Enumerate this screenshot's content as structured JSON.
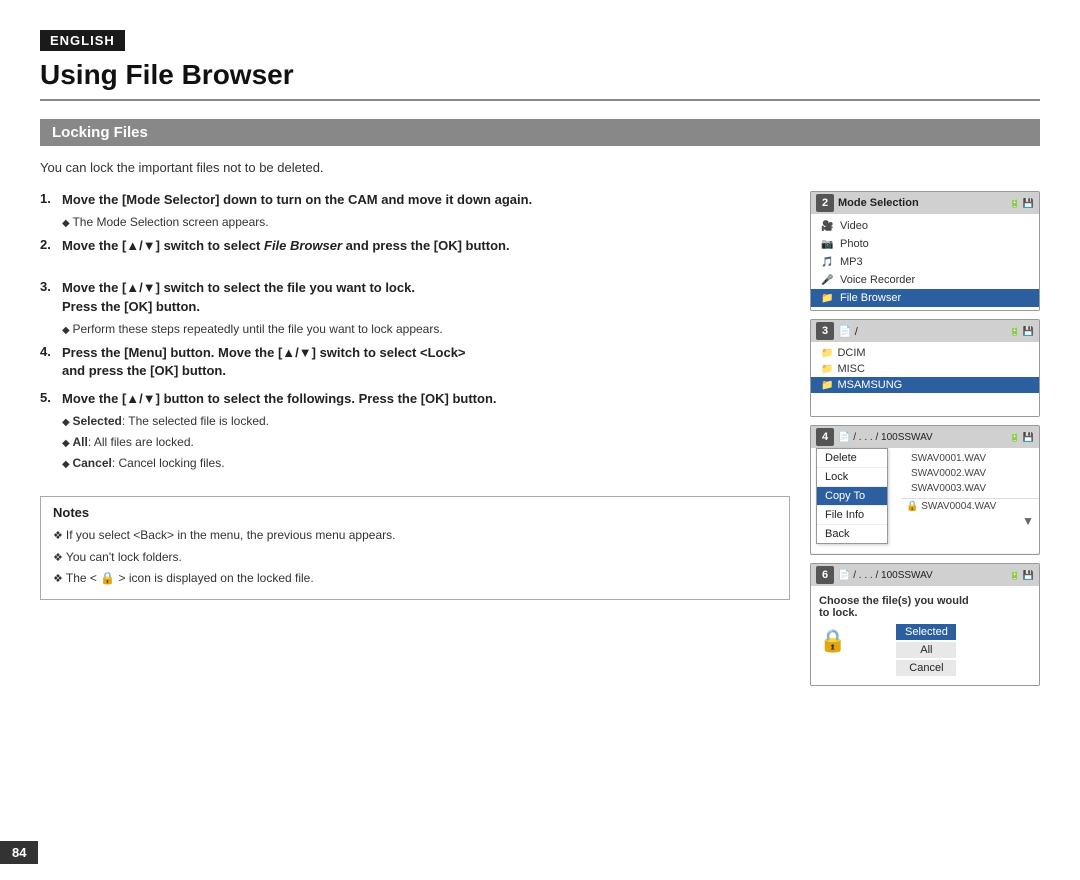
{
  "badge": "ENGLISH",
  "page_title": "Using File Browser",
  "section_title": "Locking Files",
  "intro_text": "You can lock the important files not to be deleted.",
  "steps": [
    {
      "number": "1.",
      "text": "Move the [Mode Selector] down to turn on the CAM and move it down again.",
      "sub": "The Mode Selection screen appears."
    },
    {
      "number": "2.",
      "text_prefix": "Move the [▲/▼] switch to select ",
      "text_italic": "File Browser",
      "text_suffix": " and press the [OK] button.",
      "sub": null
    },
    {
      "number": "3.",
      "text": "Move the [▲/▼] switch to select the file you want to lock.\nPress the [OK] button.",
      "sub": "Perform these steps repeatedly until the file you want to lock appears."
    },
    {
      "number": "4.",
      "text": "Press the [Menu] button. Move the [▲/▼] switch to select <Lock>\nand press the [OK] button.",
      "sub": null
    },
    {
      "number": "5.",
      "text": "Move the [▲/▼] button to select the followings. Press the [OK] button.",
      "bullets": [
        {
          "label": "Selected",
          "text": ": The selected file is locked."
        },
        {
          "label": "All",
          "text": ": All files are locked."
        },
        {
          "label": "Cancel",
          "text": ": Cancel locking files."
        }
      ]
    }
  ],
  "notes": {
    "title": "Notes",
    "items": [
      "If you select <Back> in the menu, the previous menu appears.",
      "You can't lock folders.",
      "The <  > icon is displayed on the locked file."
    ]
  },
  "page_number": "84",
  "screens": {
    "screen2": {
      "num": "2",
      "title": "Mode Selection",
      "items": [
        {
          "icon": "🎥",
          "label": "Video",
          "selected": false
        },
        {
          "icon": "📷",
          "label": "Photo",
          "selected": false
        },
        {
          "icon": "🎵",
          "label": "MP3",
          "selected": false
        },
        {
          "icon": "🎤",
          "label": "Voice Recorder",
          "selected": false
        },
        {
          "icon": "📁",
          "label": "File Browser",
          "selected": true
        }
      ]
    },
    "screen3": {
      "num": "3",
      "path": "/",
      "folders": [
        {
          "name": "DCIM",
          "selected": false
        },
        {
          "name": "MISC",
          "selected": false
        },
        {
          "name": "MSAMSUNG",
          "selected": true
        }
      ]
    },
    "screen4": {
      "num": "4",
      "path": "/ . . . / 100SSWAV",
      "files": [
        "SWAV0001.WAV",
        "SWAV0002.WAV",
        "SWAV0003.WAV",
        "SWAV0004.WAV"
      ],
      "menu": [
        {
          "label": "Delete",
          "selected": false
        },
        {
          "label": "Lock",
          "selected": false
        },
        {
          "label": "Copy To",
          "selected": true
        },
        {
          "label": "File Info",
          "selected": false
        },
        {
          "label": "Back",
          "selected": false
        }
      ]
    },
    "screen6": {
      "num": "6",
      "path": "/ . . . / 100SSWAV",
      "choose_text": "Choose the file(s) you would\nto lock.",
      "options": [
        {
          "label": "Selected",
          "selected": true
        },
        {
          "label": "All",
          "selected": false
        },
        {
          "label": "Cancel",
          "selected": false
        }
      ]
    }
  }
}
